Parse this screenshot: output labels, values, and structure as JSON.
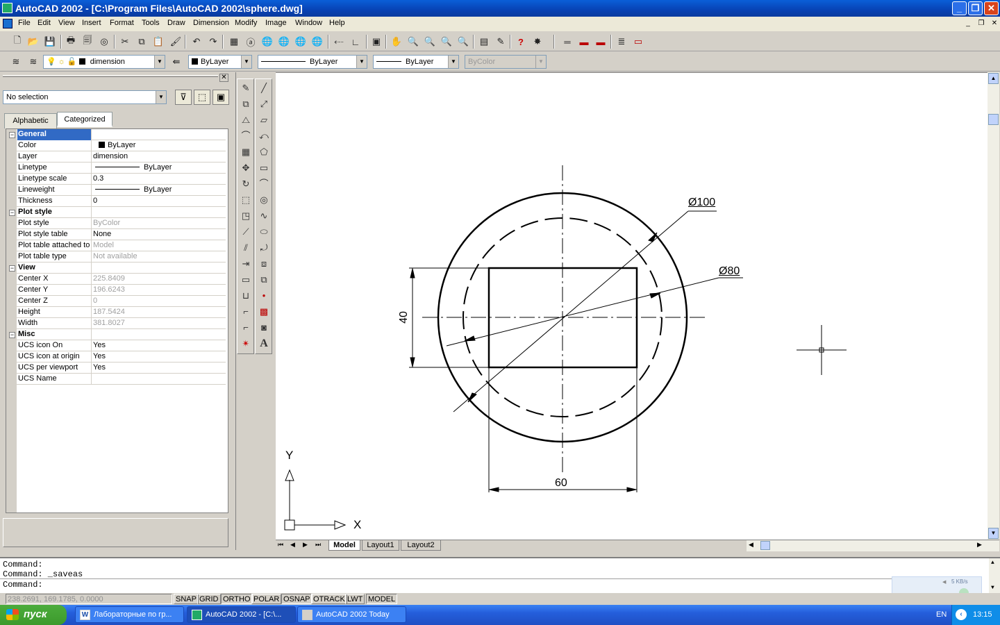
{
  "window": {
    "title": "AutoCAD 2002 - [C:\\Program Files\\AutoCAD 2002\\sphere.dwg]"
  },
  "menus": [
    "File",
    "Edit",
    "View",
    "Insert",
    "Format",
    "Tools",
    "Draw",
    "Dimension",
    "Modify",
    "Image",
    "Window",
    "Help"
  ],
  "layer_toolbar": {
    "layer": "dimension",
    "color": "ByLayer",
    "linetype": "ByLayer",
    "lineweight": "ByLayer",
    "plotstyle": "ByColor"
  },
  "properties": {
    "selection": "No selection",
    "tabs": [
      "Alphabetic",
      "Categorized"
    ],
    "active_tab": "Categorized",
    "rows": [
      {
        "type": "cat",
        "k": "General"
      },
      {
        "k": "Color",
        "v": "ByLayer",
        "swatch": true
      },
      {
        "k": "Layer",
        "v": "dimension"
      },
      {
        "k": "Linetype",
        "v": "ByLayer",
        "line": true
      },
      {
        "k": "Linetype scale",
        "v": "0.3"
      },
      {
        "k": "Lineweight",
        "v": "ByLayer",
        "line": true
      },
      {
        "k": "Thickness",
        "v": "0"
      },
      {
        "type": "cat",
        "k": "Plot style"
      },
      {
        "k": "Plot style",
        "v": "ByColor",
        "gray": true
      },
      {
        "k": "Plot style table",
        "v": "None"
      },
      {
        "k": "Plot table attached to",
        "v": "Model",
        "gray": true
      },
      {
        "k": "Plot table type",
        "v": "Not available",
        "gray": true
      },
      {
        "type": "cat",
        "k": "View"
      },
      {
        "k": "Center X",
        "v": "225.8409",
        "gray": true
      },
      {
        "k": "Center Y",
        "v": "196.6243",
        "gray": true
      },
      {
        "k": "Center Z",
        "v": "0",
        "gray": true
      },
      {
        "k": "Height",
        "v": "187.5424",
        "gray": true
      },
      {
        "k": "Width",
        "v": "381.8027",
        "gray": true
      },
      {
        "type": "cat",
        "k": "Misc"
      },
      {
        "k": "UCS icon On",
        "v": "Yes"
      },
      {
        "k": "UCS icon at origin",
        "v": "Yes"
      },
      {
        "k": "UCS per viewport",
        "v": "Yes"
      },
      {
        "k": "UCS Name",
        "v": ""
      }
    ]
  },
  "drawing": {
    "dims": {
      "outer": "Ø100",
      "inner": "Ø80",
      "height": "40",
      "width": "60"
    },
    "ucs": {
      "x": "X",
      "y": "Y"
    }
  },
  "layout_tabs": [
    "Model",
    "Layout1",
    "Layout2"
  ],
  "command_lines": [
    "Command:",
    "Command: _saveas",
    "Command:"
  ],
  "status": {
    "coords": "238.2691, 169.1785, 0.0000",
    "toggles": [
      "SNAP",
      "GRID",
      "ORTHO",
      "POLAR",
      "OSNAP",
      "OTRACK",
      "LWT",
      "MODEL"
    ]
  },
  "net_meter": "5 KB/s",
  "taskbar": {
    "start": "пуск",
    "tasks": [
      "Лабораторные по гр...",
      "AutoCAD 2002 - [C:\\...",
      "AutoCAD 2002 Today"
    ],
    "lang": "EN",
    "time": "13:15"
  }
}
